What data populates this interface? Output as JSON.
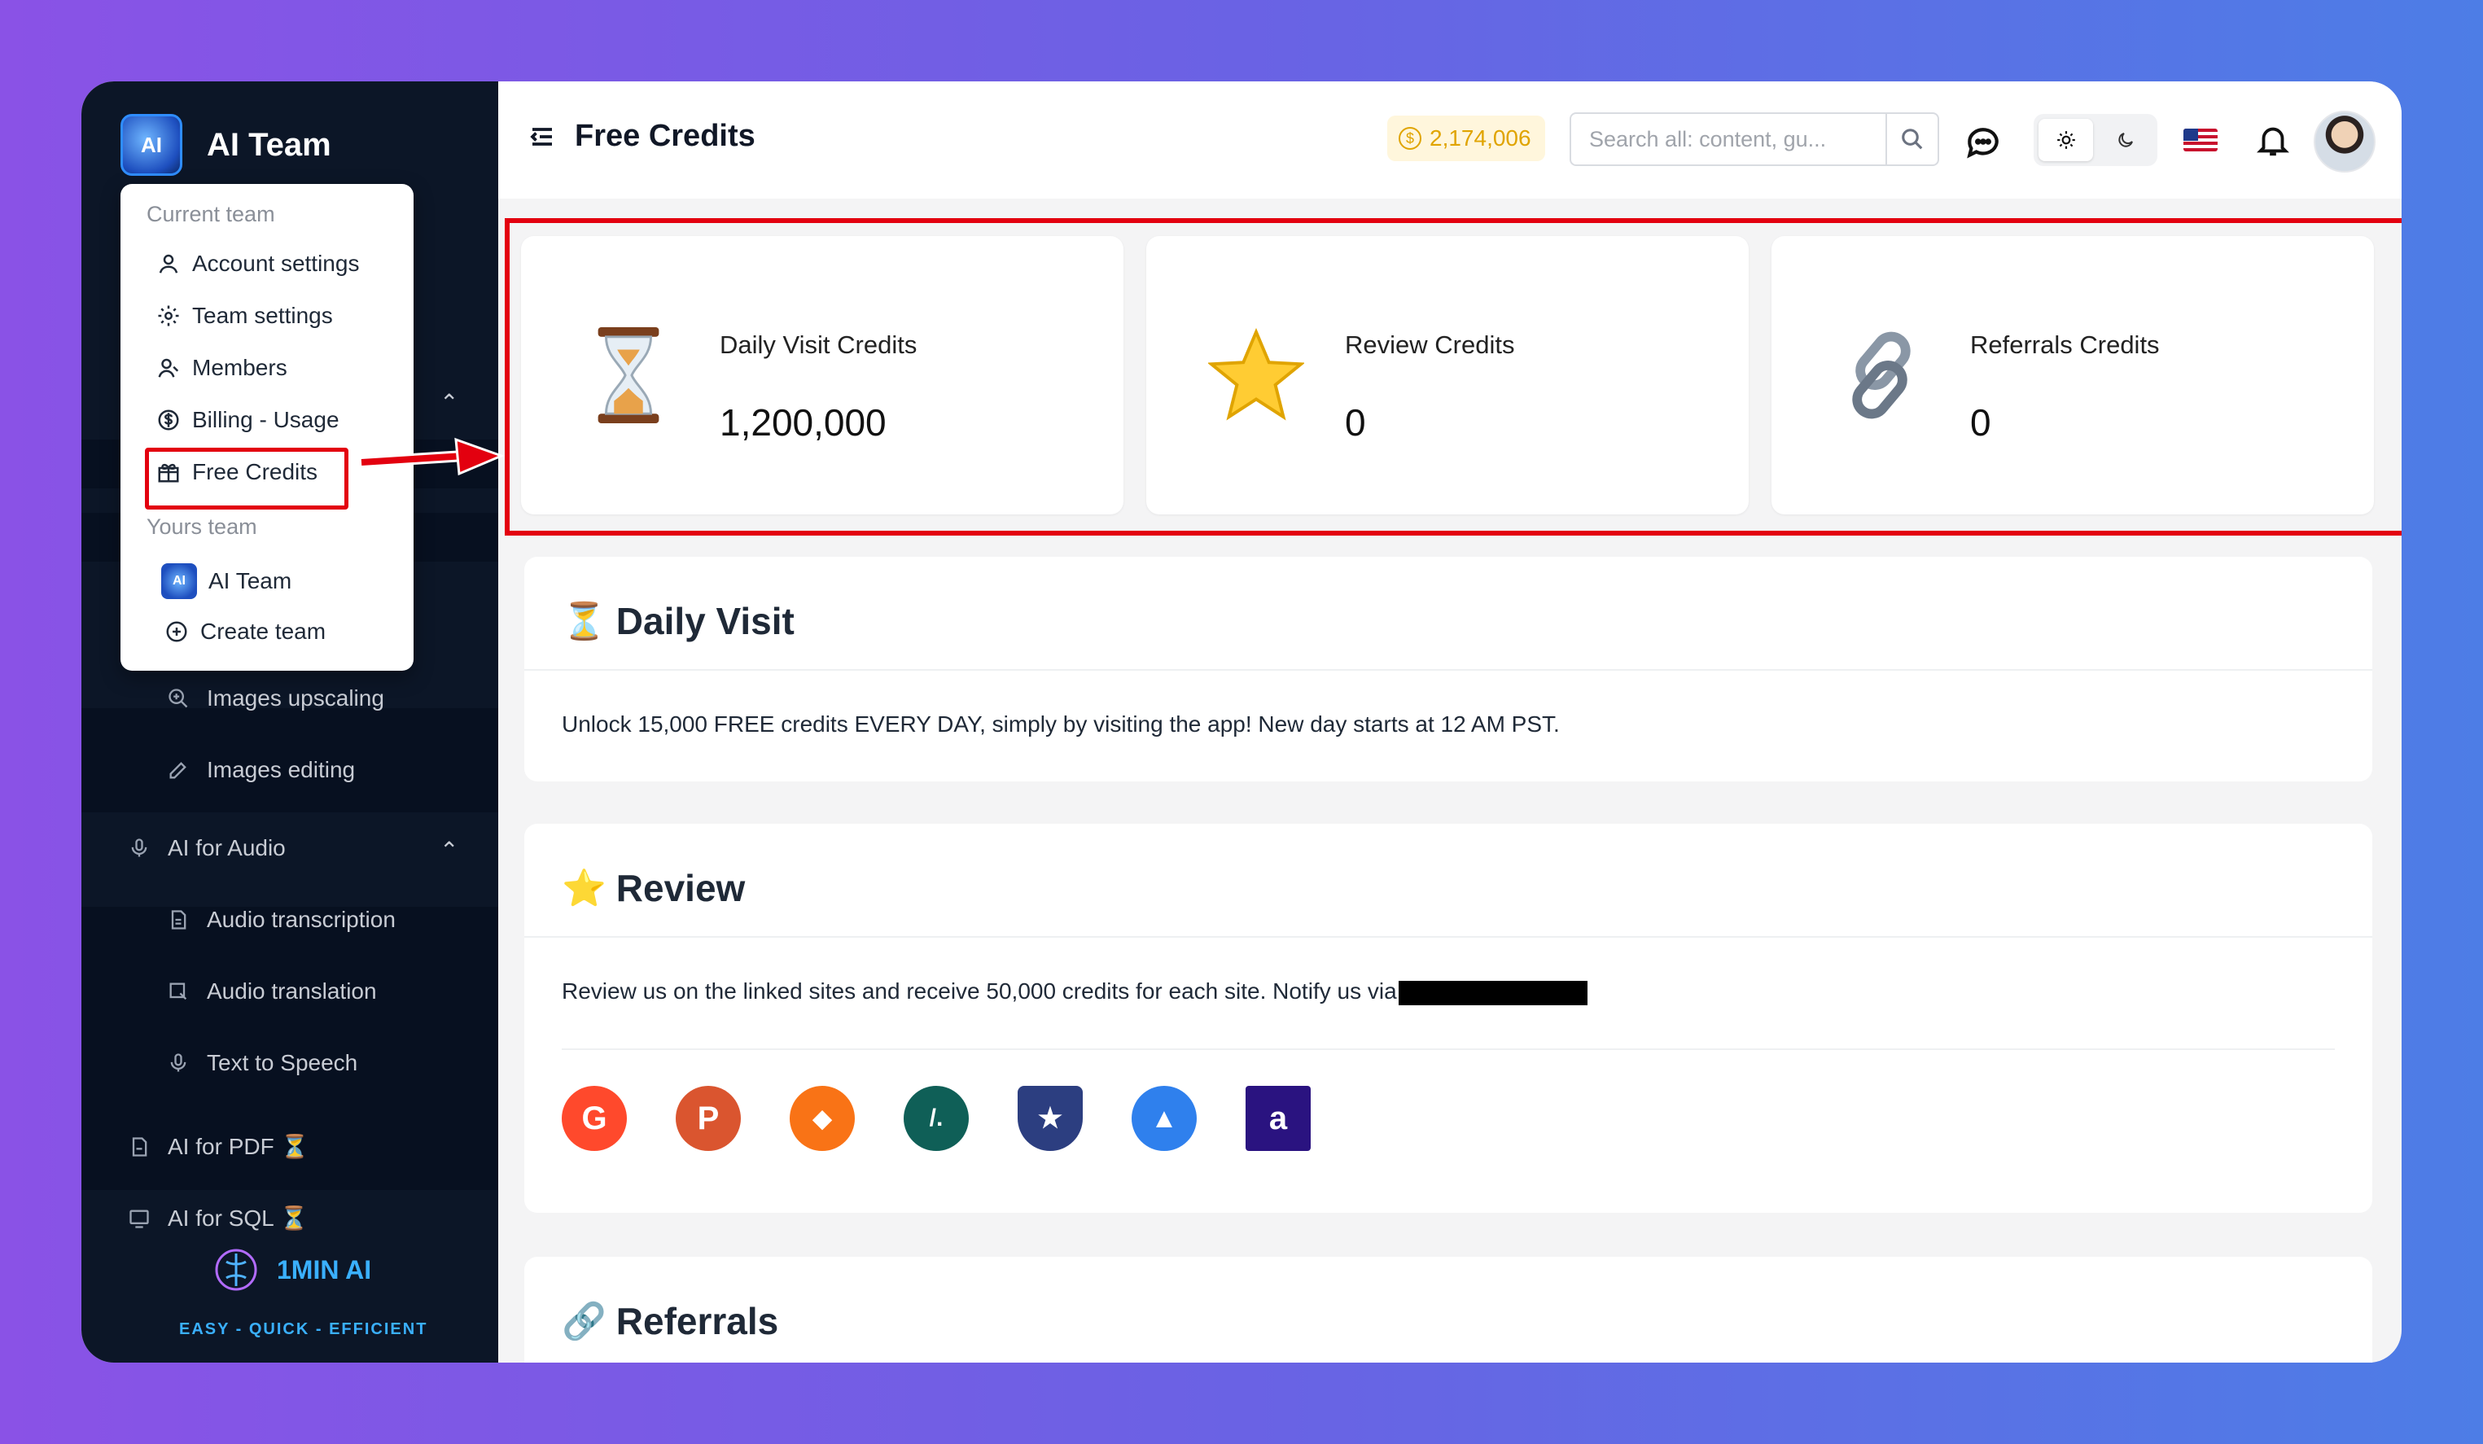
{
  "sidebar": {
    "brand": "AI Team",
    "brand_logo_text": "AI",
    "items": [
      {
        "label": "Images upscaling",
        "icon": "zoom-in-icon"
      },
      {
        "label": "Images editing",
        "icon": "pencil-icon"
      },
      {
        "label": "AI for Audio",
        "icon": "microphone-icon"
      },
      {
        "label": "Audio transcription",
        "icon": "document-icon"
      },
      {
        "label": "Audio translation",
        "icon": "image-translate-icon"
      },
      {
        "label": "Text to Speech",
        "icon": "microphone-icon"
      },
      {
        "label": "AI for PDF ⏳",
        "icon": "pdf-icon"
      },
      {
        "label": "AI for SQL ⏳",
        "icon": "sql-icon"
      }
    ],
    "footer_name": "1MIN AI",
    "footer_tagline": "EASY - QUICK - EFFICIENT"
  },
  "menu": {
    "current_team_header": "Current team",
    "items": [
      "Account settings",
      "Team settings",
      "Members",
      "Billing - Usage",
      "Free Credits"
    ],
    "yours_team_header": "Yours team",
    "team_name": "AI Team",
    "create_team": "Create team"
  },
  "topbar": {
    "title": "Free Credits",
    "credits": "2,174,006",
    "search_placeholder": "Search all: content, gu..."
  },
  "stats": [
    {
      "label": "Daily Visit Credits",
      "value": "1,200,000",
      "icon": "hourglass-icon"
    },
    {
      "label": "Review Credits",
      "value": "0",
      "icon": "star-icon"
    },
    {
      "label": "Referrals Credits",
      "value": "0",
      "icon": "link-icon"
    }
  ],
  "daily": {
    "emoji": "⏳",
    "title": "Daily Visit",
    "text": "Unlock 15,000 FREE credits EVERY DAY, simply by visiting the app! New day starts at 12 AM PST."
  },
  "review": {
    "emoji": "⭐",
    "title": "Review",
    "text": "Review us on the linked sites and receive 50,000 credits for each site. Notify us via",
    "sites": [
      {
        "name": "G2",
        "color": "#ff492c"
      },
      {
        "name": "Product Hunt",
        "color": "#da552f"
      },
      {
        "name": "AlternativeTo",
        "color": "#f97316"
      },
      {
        "name": "Futurepedia",
        "color": "#0f5f57"
      },
      {
        "name": "Trustpilot shield",
        "color": "#2c3e80"
      },
      {
        "name": "Appsumo",
        "color": "#2f80ed"
      },
      {
        "name": "AI directory",
        "color": "#2a1380"
      }
    ],
    "site_glyphs": [
      "G",
      "P",
      "◆",
      "/.",
      "★",
      "▲",
      "a"
    ]
  },
  "referrals": {
    "emoji": "🔗",
    "title": "Referrals"
  }
}
